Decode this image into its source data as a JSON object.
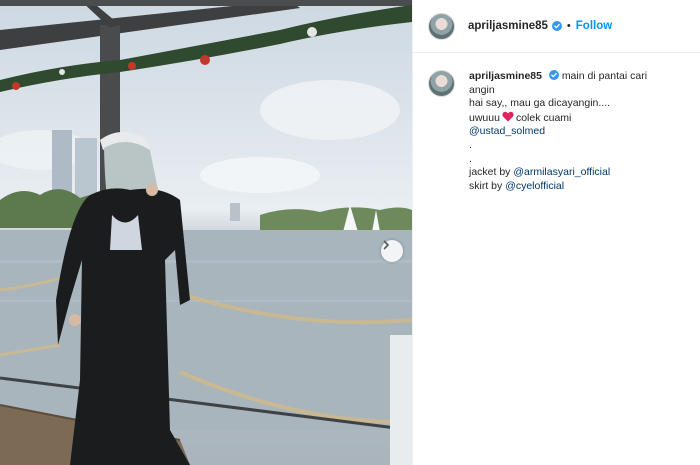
{
  "post": {
    "username": "apriljasmine85",
    "follow_label": "Follow",
    "separator": "•",
    "more_label": "···"
  },
  "caption": {
    "username": "apriljasmine85",
    "line1": "main di pantai cari",
    "line2": "angin",
    "line3": "hai say,, mau ga dicayangin....",
    "line4_pre": "uwuuu",
    "line4_post": "colek cuami",
    "mention1": "@ustad_solmed",
    "dot1": ".",
    "dot2": ".",
    "jacket_pre": "jacket by",
    "mention2": "@armilasyari_official",
    "skirt_pre": "skirt by",
    "mention3": "@cyelofficial"
  },
  "icons": {
    "verified": "verified-badge-icon",
    "heart": "red-heart-icon",
    "chevron": "chevron-right-icon"
  },
  "colors": {
    "follow": "#0095f6",
    "mention": "#00376b",
    "verified": "#3897f0",
    "heart": "#e0245e"
  }
}
